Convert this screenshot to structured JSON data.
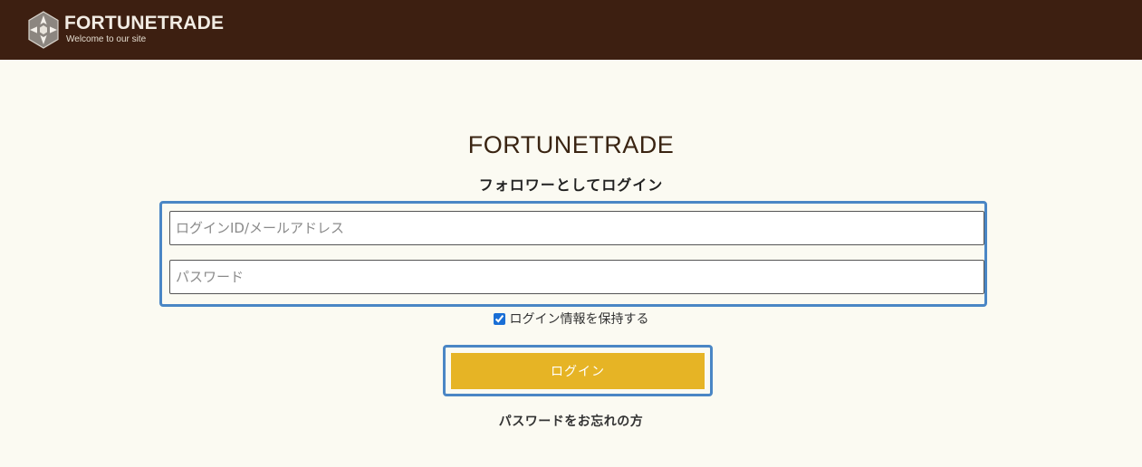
{
  "header": {
    "logo_name": "FORTUNETRADE",
    "logo_tagline": "Welcome to our site",
    "logo_icon": "hexagon-star-logo-icon"
  },
  "main": {
    "site_title": "FORTUNETRADE",
    "subtitle": "フォロワーとしてログイン",
    "login_id_placeholder": "ログインID/メールアドレス",
    "password_placeholder": "パスワード",
    "remember_label": "ログイン情報を保持する",
    "remember_checked": true,
    "login_button": "ログイン",
    "forgot_link": "パスワードをお忘れの方"
  },
  "colors": {
    "header_bg": "#3d1f11",
    "page_bg": "#fbfaf2",
    "accent_outline": "#4a86c5",
    "button_bg": "#e6b425"
  }
}
